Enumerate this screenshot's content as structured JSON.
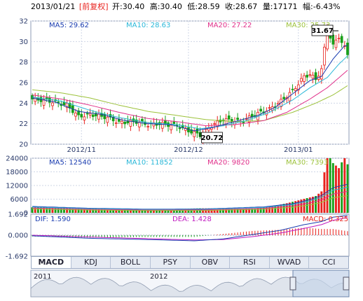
{
  "header": {
    "date": "2013/01/21",
    "adjust": "[前复权]",
    "open": "开:30.40",
    "high": "高:30.40",
    "low": "低:28.59",
    "close": "收:28.67",
    "volume": "量:17171",
    "change": "幅:-6.43%"
  },
  "colors": {
    "up": "#e8211c",
    "down": "#18a01a",
    "ma5": "#1a3cb0",
    "ma10": "#29b7d8",
    "ma20": "#e0308a",
    "ma30": "#9cc23a",
    "grid": "#cfd6e6",
    "dif": "#1a3cb0",
    "dea": "#c018c0"
  },
  "tabs": [
    "MACD",
    "KDJ",
    "BOLL",
    "PSY",
    "OBV",
    "RSI",
    "WVAD",
    "CCI"
  ],
  "active_tab": "MACD",
  "chart_data": [
    {
      "type": "candlestick",
      "title": "",
      "legend": [
        {
          "label": "MA5: 29.62",
          "color": "#1a3cb0"
        },
        {
          "label": "MA10: 28.63",
          "color": "#29b7d8"
        },
        {
          "label": "MA20: 27.22",
          "color": "#e0308a"
        },
        {
          "label": "MA30: 25.73",
          "color": "#9cc23a"
        }
      ],
      "ylim": [
        20,
        32
      ],
      "yticks": [
        "32",
        "30",
        "28",
        "26",
        "24",
        "22",
        "20"
      ],
      "xticks": [
        "2012/11",
        "2012/12",
        "2013/01"
      ],
      "xtick_index": [
        17,
        54,
        92
      ],
      "annotations": {
        "high": "31.67",
        "low": "20.72",
        "high_index": 102,
        "low_index": 58
      },
      "n": 110,
      "close_path": [
        [
          0,
          24.4
        ],
        [
          6,
          24.2
        ],
        [
          12,
          23.8
        ],
        [
          16,
          22.7
        ],
        [
          20,
          22.9
        ],
        [
          26,
          22.6
        ],
        [
          30,
          22.1
        ],
        [
          36,
          22.2
        ],
        [
          40,
          21.9
        ],
        [
          44,
          22.0
        ],
        [
          50,
          21.8
        ],
        [
          54,
          21.3
        ],
        [
          58,
          20.9
        ],
        [
          62,
          21.8
        ],
        [
          66,
          22.4
        ],
        [
          72,
          22.2
        ],
        [
          78,
          23.0
        ],
        [
          82,
          23.4
        ],
        [
          86,
          24.2
        ],
        [
          90,
          25.2
        ],
        [
          94,
          26.6
        ],
        [
          96,
          26.8
        ],
        [
          98,
          26.3
        ],
        [
          100,
          27.3
        ],
        [
          102,
          31.3
        ],
        [
          104,
          29.6
        ],
        [
          106,
          30.5
        ],
        [
          108,
          29.4
        ],
        [
          109,
          28.7
        ]
      ],
      "ma5_path": [
        [
          0,
          24.5
        ],
        [
          8,
          24.1
        ],
        [
          16,
          23.2
        ],
        [
          24,
          22.9
        ],
        [
          32,
          22.3
        ],
        [
          40,
          22.0
        ],
        [
          48,
          21.9
        ],
        [
          56,
          21.3
        ],
        [
          62,
          21.6
        ],
        [
          70,
          22.2
        ],
        [
          78,
          22.8
        ],
        [
          84,
          23.6
        ],
        [
          90,
          24.9
        ],
        [
          96,
          26.2
        ],
        [
          100,
          26.6
        ],
        [
          104,
          28.3
        ],
        [
          108,
          29.6
        ],
        [
          109,
          29.6
        ]
      ],
      "ma10_path": [
        [
          0,
          24.6
        ],
        [
          10,
          24.2
        ],
        [
          20,
          23.3
        ],
        [
          30,
          22.6
        ],
        [
          40,
          22.1
        ],
        [
          50,
          21.9
        ],
        [
          58,
          21.5
        ],
        [
          66,
          21.8
        ],
        [
          74,
          22.3
        ],
        [
          82,
          23.1
        ],
        [
          90,
          24.3
        ],
        [
          96,
          25.5
        ],
        [
          102,
          26.5
        ],
        [
          106,
          27.8
        ],
        [
          109,
          28.6
        ]
      ],
      "ma20_path": [
        [
          0,
          24.8
        ],
        [
          10,
          24.4
        ],
        [
          20,
          23.8
        ],
        [
          30,
          23.1
        ],
        [
          40,
          22.5
        ],
        [
          50,
          22.2
        ],
        [
          60,
          21.8
        ],
        [
          70,
          21.9
        ],
        [
          80,
          22.3
        ],
        [
          88,
          23.1
        ],
        [
          96,
          24.4
        ],
        [
          102,
          25.5
        ],
        [
          109,
          27.2
        ]
      ],
      "ma30_path": [
        [
          0,
          25.3
        ],
        [
          10,
          25.0
        ],
        [
          20,
          24.5
        ],
        [
          30,
          23.8
        ],
        [
          40,
          23.2
        ],
        [
          50,
          22.8
        ],
        [
          60,
          22.4
        ],
        [
          70,
          22.2
        ],
        [
          80,
          22.3
        ],
        [
          90,
          23.1
        ],
        [
          98,
          24.0
        ],
        [
          104,
          24.8
        ],
        [
          109,
          25.7
        ]
      ]
    },
    {
      "type": "bar",
      "title": "",
      "legend": [
        {
          "label": "MA5: 12540",
          "color": "#1a3cb0"
        },
        {
          "label": "MA10: 11852",
          "color": "#29b7d8"
        },
        {
          "label": "MA20: 9820",
          "color": "#e0308a"
        },
        {
          "label": "MA30: 7393",
          "color": "#9cc23a"
        }
      ],
      "ylim": [
        0,
        24000
      ],
      "yticks": [
        "24000",
        "18000",
        "12000",
        "6000",
        "0"
      ],
      "volume_path": [
        [
          0,
          3200
        ],
        [
          10,
          2400
        ],
        [
          20,
          1800
        ],
        [
          30,
          1500
        ],
        [
          40,
          1300
        ],
        [
          50,
          1400
        ],
        [
          58,
          1800
        ],
        [
          66,
          2000
        ],
        [
          74,
          2300
        ],
        [
          82,
          3000
        ],
        [
          88,
          4200
        ],
        [
          94,
          5600
        ],
        [
          98,
          6400
        ],
        [
          100,
          8000
        ],
        [
          102,
          22000
        ],
        [
          104,
          18000
        ],
        [
          106,
          16000
        ],
        [
          108,
          20000
        ],
        [
          109,
          17171
        ]
      ],
      "vma_path": [
        [
          0,
          2800
        ],
        [
          20,
          2000
        ],
        [
          40,
          1600
        ],
        [
          60,
          1700
        ],
        [
          80,
          2600
        ],
        [
          90,
          4000
        ],
        [
          96,
          5800
        ],
        [
          100,
          7600
        ],
        [
          104,
          11000
        ],
        [
          109,
          12540
        ]
      ]
    },
    {
      "type": "line",
      "title": "",
      "legend": [
        {
          "label": "DIF: 1.590",
          "color": "#1a3cb0"
        },
        {
          "label": "DEA: 1.428",
          "color": "#c018c0"
        },
        {
          "label": "MACD: 0.325",
          "color": "#e8211c"
        }
      ],
      "ylim": [
        -1.692,
        1.692
      ],
      "yticks": [
        "1.692",
        "0.000",
        "-1.692"
      ],
      "dif_path": [
        [
          0,
          -0.05
        ],
        [
          20,
          -0.25
        ],
        [
          40,
          -0.35
        ],
        [
          56,
          -0.45
        ],
        [
          66,
          -0.3
        ],
        [
          76,
          0.05
        ],
        [
          86,
          0.4
        ],
        [
          94,
          0.85
        ],
        [
          100,
          1.1
        ],
        [
          104,
          1.45
        ],
        [
          109,
          1.59
        ]
      ],
      "dea_path": [
        [
          0,
          0.0
        ],
        [
          20,
          -0.15
        ],
        [
          40,
          -0.28
        ],
        [
          56,
          -0.38
        ],
        [
          66,
          -0.35
        ],
        [
          76,
          -0.12
        ],
        [
          86,
          0.18
        ],
        [
          94,
          0.55
        ],
        [
          100,
          0.85
        ],
        [
          104,
          1.2
        ],
        [
          109,
          1.428
        ]
      ]
    }
  ],
  "overview": {
    "labels": [
      "2011",
      "2012"
    ]
  }
}
